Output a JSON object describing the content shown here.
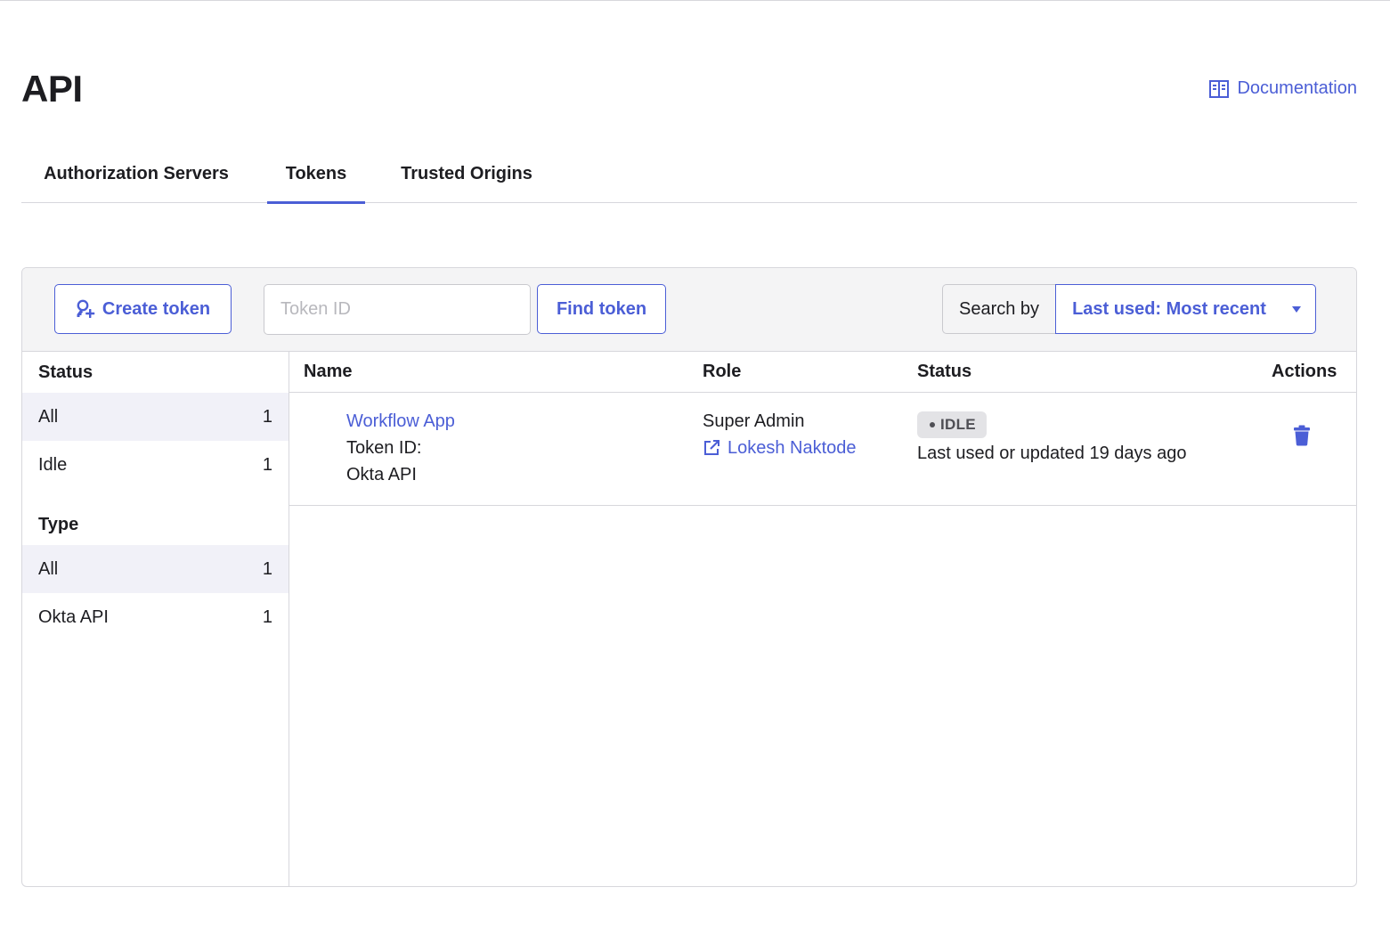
{
  "page": {
    "title": "API",
    "documentation_label": "Documentation"
  },
  "tabs": [
    {
      "label": "Authorization Servers"
    },
    {
      "label": "Tokens"
    },
    {
      "label": "Trusted Origins"
    }
  ],
  "toolbar": {
    "create_label": "Create token",
    "token_placeholder": "Token ID",
    "find_label": "Find token",
    "search_by_label": "Search by",
    "sort_value": "Last used: Most recent"
  },
  "sidebar": {
    "status_heading": "Status",
    "status_items": [
      {
        "label": "All",
        "count": "1"
      },
      {
        "label": "Idle",
        "count": "1"
      }
    ],
    "type_heading": "Type",
    "type_items": [
      {
        "label": "All",
        "count": "1"
      },
      {
        "label": "Okta API",
        "count": "1"
      }
    ]
  },
  "table": {
    "headers": {
      "name": "Name",
      "role": "Role",
      "status": "Status",
      "actions": "Actions"
    },
    "rows": [
      {
        "name": "Workflow App",
        "token_id_label": "Token ID:",
        "type": "Okta API",
        "role": "Super Admin",
        "owner": "Lokesh Naktode",
        "status_badge": "IDLE",
        "status_detail": "Last used or updated 19 days ago"
      }
    ]
  },
  "colors": {
    "accent": "#4b5ed6",
    "border": "#d7d7dc",
    "toolbar_bg": "#f4f4f5",
    "selected_bg": "#f1f1f8"
  }
}
